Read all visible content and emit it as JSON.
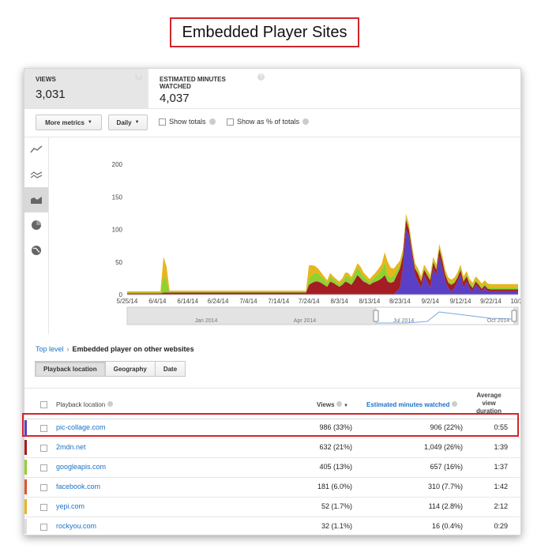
{
  "page_title": "Embedded Player Sites",
  "metrics": [
    {
      "label": "VIEWS",
      "value": "3,031"
    },
    {
      "label": "ESTIMATED MINUTES WATCHED",
      "value": "4,037"
    }
  ],
  "toolbar": {
    "more_metrics": "More metrics",
    "period": "Daily",
    "show_totals": "Show totals",
    "show_percent": "Show as % of totals"
  },
  "sidebar_icons": [
    "line-chart-icon",
    "multiline-chart-icon",
    "stacked-area-chart-icon",
    "pie-chart-icon",
    "globe-map-icon"
  ],
  "chart_data": {
    "type": "area",
    "stacked": true,
    "y_ticks": [
      "200",
      "150",
      "100",
      "50",
      "0"
    ],
    "ylim": [
      0,
      200
    ],
    "x_ticks": [
      "5/25/14",
      "6/4/14",
      "6/14/14",
      "6/24/14",
      "7/4/14",
      "7/14/14",
      "7/24/14",
      "8/3/14",
      "8/13/14",
      "8/23/14",
      "9/2/14",
      "9/12/14",
      "9/22/14",
      "10/2/14"
    ],
    "x_positions": [
      0,
      10,
      20,
      30,
      40,
      50,
      60,
      70,
      80,
      90,
      100,
      110,
      120,
      130
    ],
    "series": [
      {
        "color": "#5b3fc4",
        "values": [
          0,
          0,
          0,
          0,
          0,
          0,
          0,
          0,
          0,
          0,
          0,
          0,
          0,
          0,
          0,
          0,
          0,
          0,
          0,
          0,
          0,
          0,
          0,
          0,
          0,
          0,
          0,
          0,
          0,
          0,
          0,
          0,
          0,
          0,
          0,
          0,
          0,
          0,
          0,
          0,
          0,
          0,
          0,
          0,
          0,
          0,
          0,
          0,
          0,
          0,
          0,
          0,
          0,
          0,
          0,
          0,
          0,
          0,
          0,
          0,
          0,
          0,
          0,
          0,
          0,
          0,
          0,
          0,
          0,
          0,
          0,
          0,
          0,
          0,
          0,
          0,
          0,
          0,
          0,
          0,
          0,
          0,
          0,
          0,
          0,
          0,
          0,
          0,
          0,
          5,
          10,
          40,
          100,
          90,
          60,
          30,
          20,
          10,
          30,
          20,
          10,
          40,
          30,
          60,
          40,
          20,
          10,
          5,
          10,
          20,
          30,
          10,
          20,
          10,
          5,
          15,
          10,
          5,
          10,
          5,
          5,
          5,
          5,
          5,
          5,
          5,
          5,
          5,
          5,
          5
        ]
      },
      {
        "color": "#a41d24",
        "values": [
          2,
          2,
          2,
          2,
          2,
          2,
          2,
          2,
          2,
          2,
          2,
          2,
          3,
          3,
          3,
          3,
          3,
          3,
          3,
          3,
          3,
          3,
          3,
          3,
          3,
          3,
          3,
          3,
          3,
          3,
          3,
          3,
          3,
          3,
          3,
          3,
          3,
          3,
          3,
          3,
          3,
          3,
          3,
          3,
          3,
          3,
          3,
          3,
          3,
          3,
          3,
          3,
          3,
          3,
          3,
          3,
          3,
          3,
          3,
          3,
          15,
          18,
          20,
          20,
          18,
          15,
          12,
          20,
          18,
          15,
          12,
          15,
          20,
          18,
          15,
          22,
          30,
          25,
          20,
          18,
          15,
          18,
          20,
          22,
          25,
          30,
          20,
          18,
          20,
          25,
          30,
          20,
          15,
          10,
          8,
          10,
          12,
          10,
          8,
          10,
          12,
          10,
          8,
          10,
          12,
          10,
          8,
          10,
          8,
          6,
          8,
          10,
          8,
          6,
          5,
          5,
          5,
          4,
          4,
          4,
          3,
          3,
          3,
          3,
          3,
          3,
          3,
          3,
          3,
          3,
          3
        ]
      },
      {
        "color": "#8fd12f",
        "values": [
          1,
          1,
          1,
          1,
          1,
          1,
          1,
          1,
          1,
          1,
          1,
          1,
          25,
          20,
          1,
          1,
          1,
          1,
          1,
          1,
          1,
          1,
          1,
          1,
          1,
          1,
          1,
          1,
          1,
          1,
          1,
          1,
          1,
          1,
          1,
          1,
          1,
          1,
          1,
          1,
          1,
          1,
          1,
          1,
          1,
          1,
          1,
          1,
          1,
          1,
          1,
          1,
          1,
          1,
          1,
          1,
          1,
          1,
          1,
          1,
          10,
          12,
          14,
          12,
          10,
          8,
          6,
          8,
          6,
          5,
          4,
          5,
          8,
          10,
          8,
          10,
          12,
          10,
          8,
          6,
          5,
          6,
          8,
          10,
          12,
          20,
          10,
          8,
          10,
          8,
          6,
          5,
          4,
          3,
          3,
          3,
          3,
          3,
          3,
          3,
          3,
          3,
          3,
          3,
          3,
          3,
          3,
          3,
          3,
          3,
          3,
          3,
          3,
          3,
          3,
          3,
          3,
          3,
          3,
          3,
          3,
          3,
          3,
          3,
          3,
          3,
          3,
          3,
          3,
          3,
          3
        ]
      },
      {
        "color": "#e8b51c",
        "values": [
          2,
          2,
          2,
          2,
          2,
          2,
          2,
          2,
          2,
          2,
          2,
          2,
          30,
          20,
          2,
          2,
          2,
          2,
          2,
          2,
          2,
          2,
          2,
          2,
          2,
          2,
          2,
          2,
          2,
          2,
          2,
          2,
          2,
          2,
          2,
          2,
          2,
          2,
          2,
          2,
          2,
          2,
          2,
          2,
          2,
          2,
          2,
          2,
          2,
          2,
          2,
          2,
          2,
          2,
          2,
          2,
          2,
          2,
          2,
          2,
          20,
          15,
          10,
          8,
          6,
          5,
          4,
          5,
          4,
          4,
          4,
          5,
          6,
          5,
          4,
          5,
          6,
          8,
          6,
          5,
          4,
          5,
          6,
          8,
          10,
          15,
          20,
          15,
          10,
          8,
          6,
          5,
          5,
          5,
          5,
          5,
          5,
          5,
          5,
          5,
          5,
          5,
          5,
          5,
          5,
          5,
          5,
          5,
          5,
          5,
          5,
          5,
          5,
          5,
          5,
          5,
          5,
          5,
          5,
          5,
          5,
          5,
          5,
          5,
          5,
          5,
          5,
          5,
          5,
          5,
          5
        ]
      }
    ],
    "timeline_labels": [
      "Jan 2014",
      "Apr 2014",
      "Jul 2014",
      "Oct 2014"
    ]
  },
  "breadcrumb": {
    "top": "Top level",
    "current": "Embedded player on other websites"
  },
  "segments": [
    "Playback location",
    "Geography",
    "Date"
  ],
  "table": {
    "headers": {
      "location": "Playback location",
      "views": "Views",
      "minutes": "Estimated minutes watched",
      "duration_1": "Average",
      "duration_2": "view",
      "duration_3": "duration"
    },
    "rows": [
      {
        "site": "pic-collage.com",
        "views": "986 (33%)",
        "minutes": "906 (22%)",
        "duration": "0:55",
        "color": "#5b3fc4"
      },
      {
        "site": "2mdn.net",
        "views": "632 (21%)",
        "minutes": "1,049 (26%)",
        "duration": "1:39",
        "color": "#a41d24"
      },
      {
        "site": "googleapis.com",
        "views": "405 (13%)",
        "minutes": "657 (16%)",
        "duration": "1:37",
        "color": "#8fd12f"
      },
      {
        "site": "facebook.com",
        "views": "181 (6.0%)",
        "minutes": "310 (7.7%)",
        "duration": "1:42",
        "color": "#e0522a"
      },
      {
        "site": "yepi.com",
        "views": "52 (1.7%)",
        "minutes": "114 (2.8%)",
        "duration": "2:12",
        "color": "#e8b51c"
      },
      {
        "site": "rockyou.com",
        "views": "32 (1.1%)",
        "minutes": "16 (0.4%)",
        "duration": "0:29",
        "color": "#dddddd"
      }
    ]
  }
}
